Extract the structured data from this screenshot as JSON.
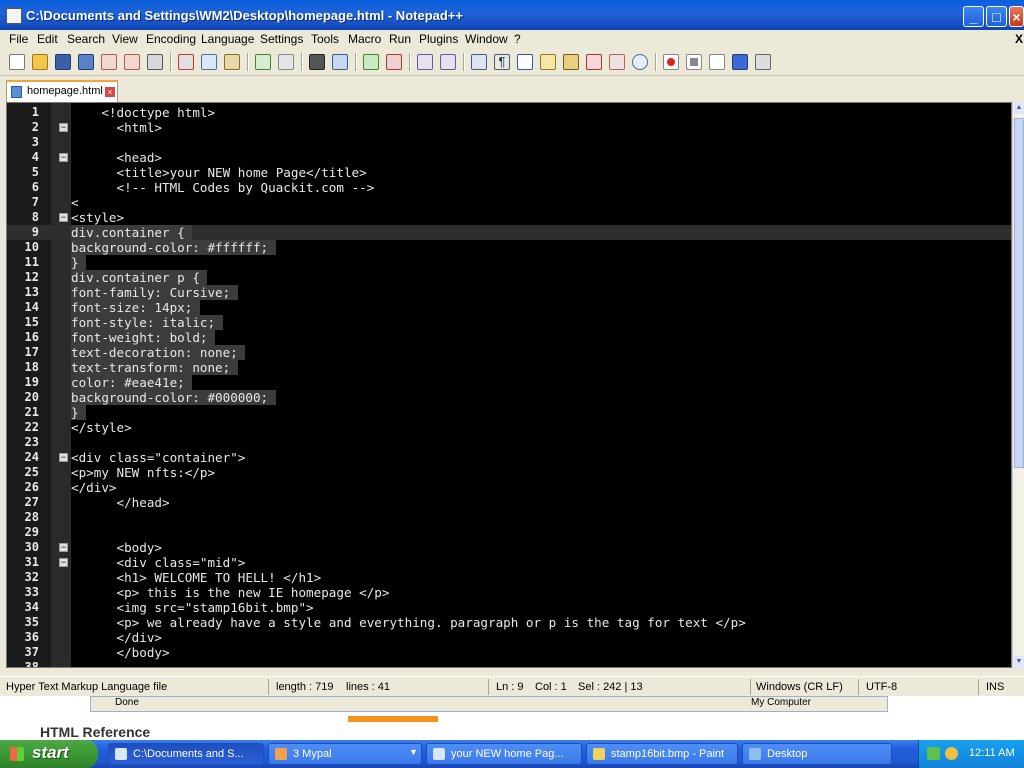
{
  "window": {
    "title": "C:\\Documents and Settings\\WM2\\Desktop\\homepage.html - Notepad++",
    "buttons": [
      "_",
      "□",
      "×"
    ]
  },
  "menu": [
    "File",
    "Edit",
    "Search",
    "View",
    "Encoding",
    "Language",
    "Settings",
    "Tools",
    "Macro",
    "Run",
    "Plugins",
    "Window",
    "?"
  ],
  "menu_close": "X",
  "toolbar_icons": [
    "new-file-icon",
    "open-file-icon",
    "save-icon",
    "save-all-icon",
    "close-icon",
    "close-all-icon",
    "print-icon",
    "cut-icon",
    "copy-icon",
    "paste-icon",
    "undo-icon",
    "redo-icon",
    "find-icon",
    "replace-icon",
    "zoom-in-icon",
    "zoom-out-icon",
    "sync-vertical-icon",
    "sync-horizontal-icon",
    "word-wrap-icon",
    "show-all-chars-icon",
    "indent-guide-icon",
    "user-lang-icon",
    "doc-map-icon",
    "function-list-icon",
    "folder-workspace-icon",
    "monitor-icon",
    "record-macro-icon",
    "stop-macro-icon",
    "play-macro-icon",
    "run-macro-multiple-icon",
    "save-macro-icon"
  ],
  "tab": {
    "label": "homepage.html"
  },
  "editor": {
    "current_line": 9,
    "lines": [
      {
        "n": "1",
        "fold": false,
        "text": "    <!doctype html>",
        "sel": false
      },
      {
        "n": "2",
        "fold": true,
        "text": "      <html>",
        "sel": false
      },
      {
        "n": "3",
        "fold": false,
        "text": "",
        "sel": false
      },
      {
        "n": "4",
        "fold": true,
        "text": "      <head>",
        "sel": false
      },
      {
        "n": "5",
        "fold": false,
        "text": "      <title>your NEW home Page</title>",
        "sel": false
      },
      {
        "n": "6",
        "fold": false,
        "text": "      <!-- HTML Codes by Quackit.com -->",
        "sel": false
      },
      {
        "n": "7",
        "fold": false,
        "text": "<",
        "sel": false
      },
      {
        "n": "8",
        "fold": true,
        "text": "<style>",
        "sel": false
      },
      {
        "n": "9",
        "fold": false,
        "text": "div.container { ",
        "sel": true
      },
      {
        "n": "10",
        "fold": false,
        "text": "background-color: #ffffff; ",
        "sel": true
      },
      {
        "n": "11",
        "fold": false,
        "text": "} ",
        "sel": true
      },
      {
        "n": "12",
        "fold": false,
        "text": "div.container p { ",
        "sel": true
      },
      {
        "n": "13",
        "fold": false,
        "text": "font-family: Cursive; ",
        "sel": true
      },
      {
        "n": "14",
        "fold": false,
        "text": "font-size: 14px; ",
        "sel": true
      },
      {
        "n": "15",
        "fold": false,
        "text": "font-style: italic; ",
        "sel": true
      },
      {
        "n": "16",
        "fold": false,
        "text": "font-weight: bold; ",
        "sel": true
      },
      {
        "n": "17",
        "fold": false,
        "text": "text-decoration: none; ",
        "sel": true
      },
      {
        "n": "18",
        "fold": false,
        "text": "text-transform: none; ",
        "sel": true
      },
      {
        "n": "19",
        "fold": false,
        "text": "color: #eae41e; ",
        "sel": true
      },
      {
        "n": "20",
        "fold": false,
        "text": "background-color: #000000; ",
        "sel": true
      },
      {
        "n": "21",
        "fold": false,
        "text": "} ",
        "sel": true
      },
      {
        "n": "22",
        "fold": false,
        "text": "</style>",
        "sel": false
      },
      {
        "n": "23",
        "fold": false,
        "text": "",
        "sel": false
      },
      {
        "n": "24",
        "fold": true,
        "text": "<div class=\"container\">",
        "sel": false
      },
      {
        "n": "25",
        "fold": false,
        "text": "<p>my NEW nfts:</p>",
        "sel": false
      },
      {
        "n": "26",
        "fold": false,
        "text": "</div>",
        "sel": false
      },
      {
        "n": "27",
        "fold": false,
        "text": "      </head>",
        "sel": false
      },
      {
        "n": "28",
        "fold": false,
        "text": "",
        "sel": false
      },
      {
        "n": "29",
        "fold": false,
        "text": "",
        "sel": false
      },
      {
        "n": "30",
        "fold": true,
        "text": "      <body>",
        "sel": false
      },
      {
        "n": "31",
        "fold": true,
        "text": "      <div class=\"mid\">",
        "sel": false
      },
      {
        "n": "32",
        "fold": false,
        "text": "      <h1> WELCOME TO HELL! </h1>",
        "sel": false
      },
      {
        "n": "33",
        "fold": false,
        "text": "      <p> this is the new IE homepage </p>",
        "sel": false
      },
      {
        "n": "34",
        "fold": false,
        "text": "      <img src=\"stamp16bit.bmp\">",
        "sel": false
      },
      {
        "n": "35",
        "fold": false,
        "text": "      <p> we already have a style and everything. paragraph or p is the tag for text </p>",
        "sel": false
      },
      {
        "n": "36",
        "fold": false,
        "text": "      </div>",
        "sel": false
      },
      {
        "n": "37",
        "fold": false,
        "text": "      </body>",
        "sel": false
      },
      {
        "n": "38",
        "fold": false,
        "text": "",
        "sel": false
      }
    ]
  },
  "status": {
    "file_type": "Hyper Text Markup Language file",
    "length": "length : 719",
    "lines": "lines : 41",
    "ln": "Ln : 9",
    "col": "Col : 1",
    "sel": "Sel : 242 | 13",
    "eol": "Windows (CR LF)",
    "encoding": "UTF-8",
    "mode": "INS"
  },
  "behind": {
    "ie_status": "Done",
    "ie_zone": "My Computer",
    "heading": "HTML Reference"
  },
  "taskbar": {
    "start": "start",
    "tasks": [
      {
        "label": "C:\\Documents and S...",
        "active": true
      },
      {
        "label": "3 Mypal",
        "active": false
      },
      {
        "label": "your NEW home Pag...",
        "active": false
      },
      {
        "label": "stamp16bit.bmp - Paint",
        "active": false
      },
      {
        "label": "Desktop",
        "active": false
      }
    ],
    "clock": "12:11 AM"
  }
}
